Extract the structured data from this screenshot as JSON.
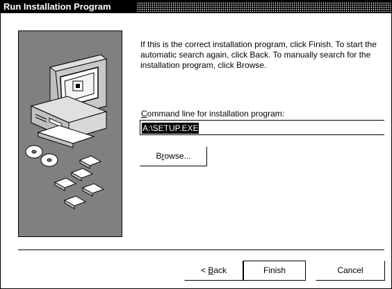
{
  "window": {
    "title": "Run Installation Program"
  },
  "instructions": "If this is the correct installation program, click Finish. To start the automatic search again, click Back. To manually search for the installation program, click Browse.",
  "command_line": {
    "label_pre": "",
    "label_mnemonic": "C",
    "label_post": "ommand line for installation program:",
    "value": "A:\\SETUP.EXE"
  },
  "buttons": {
    "browse": {
      "pre": "B",
      "mnemonic": "r",
      "post": "owse..."
    },
    "back": {
      "pre": "< ",
      "mnemonic": "B",
      "post": "ack"
    },
    "finish": "Finish",
    "cancel": "Cancel"
  },
  "icons": {
    "illustration": "computer-with-disks-illustration"
  }
}
